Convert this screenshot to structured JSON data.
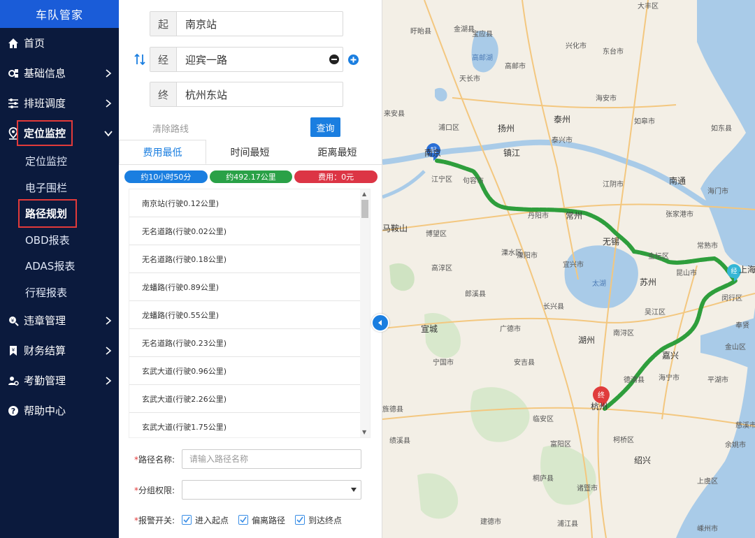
{
  "sidebar": {
    "brand": "车队管家",
    "items": [
      {
        "label": "首页",
        "icon": "home-icon"
      },
      {
        "label": "基础信息",
        "icon": "gear-cubes-icon"
      },
      {
        "label": "排班调度",
        "icon": "sliders-icon"
      },
      {
        "label": "定位监控",
        "icon": "location-pin-icon",
        "expanded": true,
        "children": [
          "定位监控",
          "电子围栏",
          "路径规划",
          "OBD报表",
          "ADAS报表",
          "行程报表"
        ],
        "active_child": "路径规划"
      },
      {
        "label": "违章管理",
        "icon": "search-money-icon"
      },
      {
        "label": "财务结算",
        "icon": "bookmark-icon"
      },
      {
        "label": "考勤管理",
        "icon": "user-gear-icon"
      },
      {
        "label": "帮助中心",
        "icon": "question-circle-icon"
      }
    ]
  },
  "route": {
    "start_tag": "起",
    "start_value": "南京站",
    "via_tag": "经",
    "via_value": "迎宾一路",
    "end_tag": "终",
    "end_value": "杭州东站",
    "clear_label": "清除路线",
    "query_label": "查询"
  },
  "tabs": [
    "费用最低",
    "时间最短",
    "距离最短"
  ],
  "summary": {
    "time": "约10小时50分",
    "distance": "约492.17公里",
    "cost": "费用：0元",
    "colors": {
      "time": "#1a7ee0",
      "distance": "#2aa147",
      "cost": "#dc3545"
    }
  },
  "steps": [
    "南京站(行驶0.12公里)",
    "无名道路(行驶0.02公里)",
    "无名道路(行驶0.18公里)",
    "龙蟠路(行驶0.89公里)",
    "龙蟠路(行驶0.55公里)",
    "无名道路(行驶0.23公里)",
    "玄武大道(行驶0.96公里)",
    "玄武大道(行驶2.26公里)",
    "玄武大道(行驶1.75公里)"
  ],
  "form": {
    "name_label": "路径名称:",
    "name_placeholder": "请输入路径名称",
    "group_label": "分组权限:",
    "alarm_label": "报警开关:",
    "alarms": [
      "进入起点",
      "偏离路径",
      "到达终点"
    ]
  },
  "map": {
    "markers": {
      "start": "起",
      "via": "经",
      "end": "终"
    },
    "route_color": "#2e9e3c",
    "labels": [
      {
        "t": "大丰区",
        "k": "town"
      },
      {
        "t": "盱眙县",
        "k": "town"
      },
      {
        "t": "金湖县",
        "k": "town"
      },
      {
        "t": "宝应县",
        "k": "town"
      },
      {
        "t": "兴化市",
        "k": "town"
      },
      {
        "t": "东台市",
        "k": "town"
      },
      {
        "t": "高邮湖",
        "k": "water"
      },
      {
        "t": "高邮市",
        "k": "town"
      },
      {
        "t": "天长市",
        "k": "town"
      },
      {
        "t": "海安市",
        "k": "town"
      },
      {
        "t": "来安县",
        "k": "town"
      },
      {
        "t": "泰州",
        "k": "city"
      },
      {
        "t": "如皋市",
        "k": "town"
      },
      {
        "t": "扬州",
        "k": "city"
      },
      {
        "t": "如东县",
        "k": "town"
      },
      {
        "t": "浦口区",
        "k": "town"
      },
      {
        "t": "泰兴市",
        "k": "town"
      },
      {
        "t": "镇江",
        "k": "city"
      },
      {
        "t": "南京",
        "k": "city"
      },
      {
        "t": "南通",
        "k": "city"
      },
      {
        "t": "海门市",
        "k": "town"
      },
      {
        "t": "江宁区",
        "k": "town"
      },
      {
        "t": "句容市",
        "k": "town"
      },
      {
        "t": "江阴市",
        "k": "town"
      },
      {
        "t": "丹阳市",
        "k": "town"
      },
      {
        "t": "张家港市",
        "k": "town"
      },
      {
        "t": "常州",
        "k": "city"
      },
      {
        "t": "马鞍山",
        "k": "city"
      },
      {
        "t": "溧水区",
        "k": "town"
      },
      {
        "t": "金坛区",
        "k": "town"
      },
      {
        "t": "无锡",
        "k": "city"
      },
      {
        "t": "常熟市",
        "k": "town"
      },
      {
        "t": "博望区",
        "k": "town"
      },
      {
        "t": "溧阳市",
        "k": "town"
      },
      {
        "t": "昆山市",
        "k": "town"
      },
      {
        "t": "高淳区",
        "k": "town"
      },
      {
        "t": "宜兴市",
        "k": "town"
      },
      {
        "t": "太湖",
        "k": "water"
      },
      {
        "t": "苏州",
        "k": "city"
      },
      {
        "t": "上海",
        "k": "city"
      },
      {
        "t": "郎溪县",
        "k": "town"
      },
      {
        "t": "长兴县",
        "k": "town"
      },
      {
        "t": "吴江区",
        "k": "town"
      },
      {
        "t": "闵行区",
        "k": "town"
      },
      {
        "t": "宣城",
        "k": "city"
      },
      {
        "t": "广德市",
        "k": "town"
      },
      {
        "t": "湖州",
        "k": "city"
      },
      {
        "t": "南浔区",
        "k": "town"
      },
      {
        "t": "嘉兴",
        "k": "city"
      },
      {
        "t": "金山区",
        "k": "town"
      },
      {
        "t": "奉贤",
        "k": "town"
      },
      {
        "t": "宁国市",
        "k": "town"
      },
      {
        "t": "安吉县",
        "k": "town"
      },
      {
        "t": "德清县",
        "k": "town"
      },
      {
        "t": "海宁市",
        "k": "town"
      },
      {
        "t": "平湖市",
        "k": "town"
      },
      {
        "t": "杭州",
        "k": "city"
      },
      {
        "t": "旌德县",
        "k": "town"
      },
      {
        "t": "临安区",
        "k": "town"
      },
      {
        "t": "绩溪县",
        "k": "town"
      },
      {
        "t": "富阳区",
        "k": "town"
      },
      {
        "t": "柯桥区",
        "k": "town"
      },
      {
        "t": "慈溪市",
        "k": "town"
      },
      {
        "t": "余姚市",
        "k": "town"
      },
      {
        "t": "绍兴",
        "k": "city"
      },
      {
        "t": "桐庐县",
        "k": "town"
      },
      {
        "t": "诸暨市",
        "k": "town"
      },
      {
        "t": "上虞区",
        "k": "town"
      },
      {
        "t": "建德市",
        "k": "town"
      },
      {
        "t": "浦江县",
        "k": "town"
      },
      {
        "t": "嵊州市",
        "k": "town"
      }
    ]
  }
}
